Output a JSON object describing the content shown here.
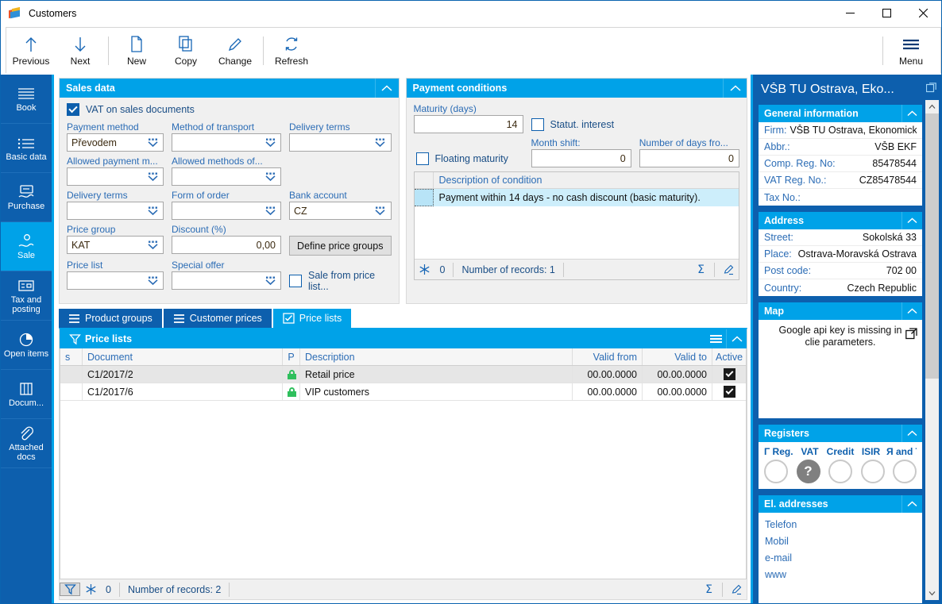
{
  "window": {
    "title": "Customers",
    "minimize": "–",
    "maximize": "□",
    "close": "✕"
  },
  "toolbar": {
    "items": [
      {
        "label": "Previous",
        "icon": "arrow-up-icon"
      },
      {
        "label": "Next",
        "icon": "arrow-down-icon"
      },
      {
        "label": "New",
        "icon": "new-document-icon"
      },
      {
        "label": "Copy",
        "icon": "copy-icon"
      },
      {
        "label": "Change",
        "icon": "pencil-icon"
      },
      {
        "label": "Refresh",
        "icon": "refresh-icon"
      }
    ],
    "menu_label": "Menu"
  },
  "sidebar": {
    "items": [
      {
        "label": "Book",
        "icon": "book-lines-icon",
        "active": false
      },
      {
        "label": "Basic data",
        "icon": "basic-data-icon",
        "active": false
      },
      {
        "label": "Purchase",
        "icon": "purchase-icon",
        "active": false
      },
      {
        "label": "Sale",
        "icon": "sale-icon",
        "active": true
      },
      {
        "label": "Tax and posting",
        "icon": "tax-posting-icon",
        "active": false
      },
      {
        "label": "Open items",
        "icon": "pie-clock-icon",
        "active": false
      },
      {
        "label": "Docum...",
        "icon": "documents-icon",
        "active": false
      },
      {
        "label": "Attached docs",
        "icon": "paperclip-icon",
        "active": false
      }
    ]
  },
  "sales_data": {
    "title": "Sales data",
    "vat_checkbox": {
      "label": "VAT on sales documents",
      "checked": true
    },
    "fields": [
      {
        "caption": "Payment method",
        "value": "Převodem"
      },
      {
        "caption": "Method of transport",
        "value": ""
      },
      {
        "caption": "Delivery terms",
        "value": ""
      },
      {
        "caption": "Allowed payment m...",
        "value": ""
      },
      {
        "caption": "Allowed methods of...",
        "value": ""
      },
      {
        "caption": "Delivery terms",
        "value": ""
      },
      {
        "caption": "Form of order",
        "value": ""
      },
      {
        "caption": "Bank account",
        "value": "CZ"
      },
      {
        "caption": "Price group",
        "value": "KAT"
      },
      {
        "caption": "Discount (%)",
        "value": "0,00"
      },
      {
        "caption": "Price list",
        "value": ""
      },
      {
        "caption": "Special offer",
        "value": ""
      }
    ],
    "define_price_groups_button": "Define price groups",
    "sale_from_price_list": {
      "label": "Sale from price list...",
      "checked": false
    }
  },
  "payment_conditions": {
    "title": "Payment conditions",
    "maturity_caption": "Maturity (days)",
    "maturity_value": "14",
    "statut_interest": {
      "label": "Statut. interest",
      "checked": false
    },
    "floating_maturity": {
      "label": "Floating maturity",
      "checked": false
    },
    "month_shift_caption": "Month shift:",
    "month_shift_value": "0",
    "days_from_caption": "Number of days fro...",
    "days_from_value": "0",
    "grid_header": "Description of condition",
    "rows": [
      "Payment within 14 days - no cash discount (basic maturity)."
    ],
    "footer": {
      "freeze_count": "0",
      "records": "Number of records: 1",
      "sum_icon": "sigma-icon",
      "edit_icon": "pencil-edit-icon"
    }
  },
  "tabs": [
    {
      "label": "Product groups",
      "icon": "list-icon",
      "active": false
    },
    {
      "label": "Customer prices",
      "icon": "list-icon",
      "active": false
    },
    {
      "label": "Price lists",
      "icon": "checklist-icon",
      "active": true
    }
  ],
  "price_lists": {
    "title": "Price lists",
    "columns": [
      "s",
      "Document",
      "P",
      "Description",
      "Valid from",
      "Valid to",
      "Active"
    ],
    "rows": [
      {
        "s": "",
        "document": "C1/2017/2",
        "p": "lock-icon",
        "description": "Retail price",
        "valid_from": "00.00.0000",
        "valid_to": "00.00.0000",
        "active": true
      },
      {
        "s": "",
        "document": "C1/2017/6",
        "p": "lock-icon",
        "description": "VIP customers",
        "valid_from": "00.00.0000",
        "valid_to": "00.00.0000",
        "active": true
      }
    ],
    "footer": {
      "freeze_count": "0",
      "records": "Number of records: 2"
    }
  },
  "right_panel": {
    "title": "VŠB TU Ostrava, Eko...",
    "general": {
      "title": "General information",
      "rows": [
        {
          "key": "Firm:",
          "value": "VŠB TU Ostrava, Ekonomická ...",
          "align": "left"
        },
        {
          "key": "Abbr.:",
          "value": "VŠB EKF",
          "align": "right"
        },
        {
          "key": "Comp. Reg. No:",
          "value": "85478544",
          "align": "right"
        },
        {
          "key": "VAT Reg. No.:",
          "value": "CZ85478544",
          "align": "right"
        },
        {
          "key": "Tax No.:",
          "value": "",
          "align": "right"
        }
      ]
    },
    "address": {
      "title": "Address",
      "rows": [
        {
          "key": "Street:",
          "value": "Sokolská 33",
          "align": "right"
        },
        {
          "key": "Place:",
          "value": "Ostrava-Moravská Ostrava",
          "align": "right"
        },
        {
          "key": "Post code:",
          "value": "702 00",
          "align": "right"
        },
        {
          "key": "Country:",
          "value": "Czech Republic",
          "align": "right"
        }
      ]
    },
    "map": {
      "title": "Map",
      "message": "Google api key is missing in clie parameters.",
      "external_icon": "external-link-icon"
    },
    "registers": {
      "title": "Registers",
      "items": [
        {
          "label": "Γ Reg. I",
          "state": "empty"
        },
        {
          "label": "VAT",
          "state": "unknown"
        },
        {
          "label": "Credit",
          "state": "empty"
        },
        {
          "label": "ISIR",
          "state": "empty"
        },
        {
          "label": "Я and Т",
          "state": "empty"
        }
      ],
      "unknown_glyph": "?"
    },
    "el_addresses": {
      "title": "El. addresses",
      "items": [
        "Telefon",
        "Mobil",
        "e-mail",
        "www"
      ]
    }
  },
  "colors": {
    "accent": "#00a2e8",
    "primary": "#0d5fad",
    "caption": "#2b6cb5",
    "lock_green": "#2fbf5d"
  }
}
